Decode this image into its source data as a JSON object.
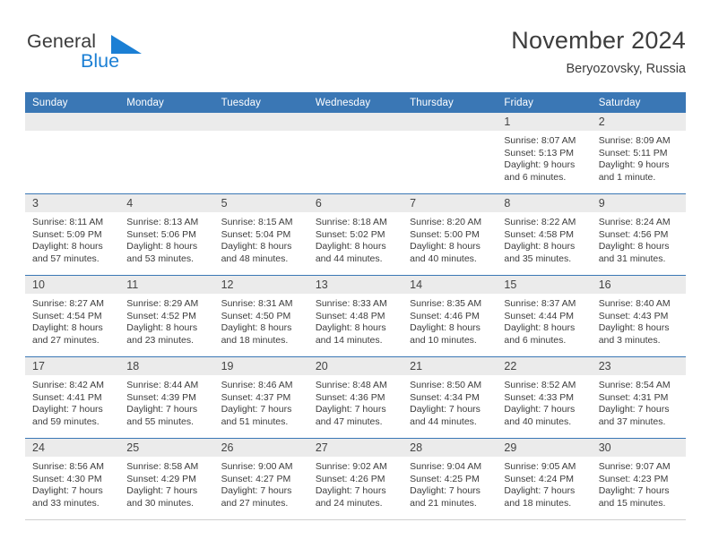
{
  "brand": {
    "name_part1": "General",
    "name_part2": "Blue",
    "mark": "triangle-flag-icon",
    "accent_color": "#1b7fd4"
  },
  "header": {
    "title": "November 2024",
    "subtitle": "Beryozovsky, Russia"
  },
  "calendar": {
    "header_color": "#3a77b5",
    "daynumber_band_color": "#ebebeb",
    "weekday_headers": [
      "Sunday",
      "Monday",
      "Tuesday",
      "Wednesday",
      "Thursday",
      "Friday",
      "Saturday"
    ],
    "weeks": [
      [
        {
          "day": "",
          "empty": true
        },
        {
          "day": "",
          "empty": true
        },
        {
          "day": "",
          "empty": true
        },
        {
          "day": "",
          "empty": true
        },
        {
          "day": "",
          "empty": true
        },
        {
          "day": "1",
          "sunrise": "Sunrise: 8:07 AM",
          "sunset": "Sunset: 5:13 PM",
          "daylight1": "Daylight: 9 hours",
          "daylight2": "and 6 minutes."
        },
        {
          "day": "2",
          "sunrise": "Sunrise: 8:09 AM",
          "sunset": "Sunset: 5:11 PM",
          "daylight1": "Daylight: 9 hours",
          "daylight2": "and 1 minute."
        }
      ],
      [
        {
          "day": "3",
          "sunrise": "Sunrise: 8:11 AM",
          "sunset": "Sunset: 5:09 PM",
          "daylight1": "Daylight: 8 hours",
          "daylight2": "and 57 minutes."
        },
        {
          "day": "4",
          "sunrise": "Sunrise: 8:13 AM",
          "sunset": "Sunset: 5:06 PM",
          "daylight1": "Daylight: 8 hours",
          "daylight2": "and 53 minutes."
        },
        {
          "day": "5",
          "sunrise": "Sunrise: 8:15 AM",
          "sunset": "Sunset: 5:04 PM",
          "daylight1": "Daylight: 8 hours",
          "daylight2": "and 48 minutes."
        },
        {
          "day": "6",
          "sunrise": "Sunrise: 8:18 AM",
          "sunset": "Sunset: 5:02 PM",
          "daylight1": "Daylight: 8 hours",
          "daylight2": "and 44 minutes."
        },
        {
          "day": "7",
          "sunrise": "Sunrise: 8:20 AM",
          "sunset": "Sunset: 5:00 PM",
          "daylight1": "Daylight: 8 hours",
          "daylight2": "and 40 minutes."
        },
        {
          "day": "8",
          "sunrise": "Sunrise: 8:22 AM",
          "sunset": "Sunset: 4:58 PM",
          "daylight1": "Daylight: 8 hours",
          "daylight2": "and 35 minutes."
        },
        {
          "day": "9",
          "sunrise": "Sunrise: 8:24 AM",
          "sunset": "Sunset: 4:56 PM",
          "daylight1": "Daylight: 8 hours",
          "daylight2": "and 31 minutes."
        }
      ],
      [
        {
          "day": "10",
          "sunrise": "Sunrise: 8:27 AM",
          "sunset": "Sunset: 4:54 PM",
          "daylight1": "Daylight: 8 hours",
          "daylight2": "and 27 minutes."
        },
        {
          "day": "11",
          "sunrise": "Sunrise: 8:29 AM",
          "sunset": "Sunset: 4:52 PM",
          "daylight1": "Daylight: 8 hours",
          "daylight2": "and 23 minutes."
        },
        {
          "day": "12",
          "sunrise": "Sunrise: 8:31 AM",
          "sunset": "Sunset: 4:50 PM",
          "daylight1": "Daylight: 8 hours",
          "daylight2": "and 18 minutes."
        },
        {
          "day": "13",
          "sunrise": "Sunrise: 8:33 AM",
          "sunset": "Sunset: 4:48 PM",
          "daylight1": "Daylight: 8 hours",
          "daylight2": "and 14 minutes."
        },
        {
          "day": "14",
          "sunrise": "Sunrise: 8:35 AM",
          "sunset": "Sunset: 4:46 PM",
          "daylight1": "Daylight: 8 hours",
          "daylight2": "and 10 minutes."
        },
        {
          "day": "15",
          "sunrise": "Sunrise: 8:37 AM",
          "sunset": "Sunset: 4:44 PM",
          "daylight1": "Daylight: 8 hours",
          "daylight2": "and 6 minutes."
        },
        {
          "day": "16",
          "sunrise": "Sunrise: 8:40 AM",
          "sunset": "Sunset: 4:43 PM",
          "daylight1": "Daylight: 8 hours",
          "daylight2": "and 3 minutes."
        }
      ],
      [
        {
          "day": "17",
          "sunrise": "Sunrise: 8:42 AM",
          "sunset": "Sunset: 4:41 PM",
          "daylight1": "Daylight: 7 hours",
          "daylight2": "and 59 minutes."
        },
        {
          "day": "18",
          "sunrise": "Sunrise: 8:44 AM",
          "sunset": "Sunset: 4:39 PM",
          "daylight1": "Daylight: 7 hours",
          "daylight2": "and 55 minutes."
        },
        {
          "day": "19",
          "sunrise": "Sunrise: 8:46 AM",
          "sunset": "Sunset: 4:37 PM",
          "daylight1": "Daylight: 7 hours",
          "daylight2": "and 51 minutes."
        },
        {
          "day": "20",
          "sunrise": "Sunrise: 8:48 AM",
          "sunset": "Sunset: 4:36 PM",
          "daylight1": "Daylight: 7 hours",
          "daylight2": "and 47 minutes."
        },
        {
          "day": "21",
          "sunrise": "Sunrise: 8:50 AM",
          "sunset": "Sunset: 4:34 PM",
          "daylight1": "Daylight: 7 hours",
          "daylight2": "and 44 minutes."
        },
        {
          "day": "22",
          "sunrise": "Sunrise: 8:52 AM",
          "sunset": "Sunset: 4:33 PM",
          "daylight1": "Daylight: 7 hours",
          "daylight2": "and 40 minutes."
        },
        {
          "day": "23",
          "sunrise": "Sunrise: 8:54 AM",
          "sunset": "Sunset: 4:31 PM",
          "daylight1": "Daylight: 7 hours",
          "daylight2": "and 37 minutes."
        }
      ],
      [
        {
          "day": "24",
          "sunrise": "Sunrise: 8:56 AM",
          "sunset": "Sunset: 4:30 PM",
          "daylight1": "Daylight: 7 hours",
          "daylight2": "and 33 minutes."
        },
        {
          "day": "25",
          "sunrise": "Sunrise: 8:58 AM",
          "sunset": "Sunset: 4:29 PM",
          "daylight1": "Daylight: 7 hours",
          "daylight2": "and 30 minutes."
        },
        {
          "day": "26",
          "sunrise": "Sunrise: 9:00 AM",
          "sunset": "Sunset: 4:27 PM",
          "daylight1": "Daylight: 7 hours",
          "daylight2": "and 27 minutes."
        },
        {
          "day": "27",
          "sunrise": "Sunrise: 9:02 AM",
          "sunset": "Sunset: 4:26 PM",
          "daylight1": "Daylight: 7 hours",
          "daylight2": "and 24 minutes."
        },
        {
          "day": "28",
          "sunrise": "Sunrise: 9:04 AM",
          "sunset": "Sunset: 4:25 PM",
          "daylight1": "Daylight: 7 hours",
          "daylight2": "and 21 minutes."
        },
        {
          "day": "29",
          "sunrise": "Sunrise: 9:05 AM",
          "sunset": "Sunset: 4:24 PM",
          "daylight1": "Daylight: 7 hours",
          "daylight2": "and 18 minutes."
        },
        {
          "day": "30",
          "sunrise": "Sunrise: 9:07 AM",
          "sunset": "Sunset: 4:23 PM",
          "daylight1": "Daylight: 7 hours",
          "daylight2": "and 15 minutes."
        }
      ]
    ]
  }
}
